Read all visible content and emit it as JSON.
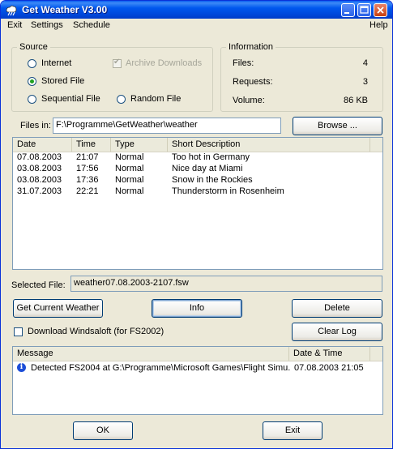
{
  "window": {
    "title": "Get Weather V3.00"
  },
  "menu": [
    "Exit",
    "Settings",
    "Schedule",
    "Help"
  ],
  "source": {
    "title": "Source",
    "internet": "Internet",
    "stored_file": "Stored File",
    "sequential_file": "Sequential File",
    "random_file": "Random File",
    "archive_downloads": "Archive Downloads",
    "selected": "Stored File"
  },
  "information": {
    "title": "Information",
    "rows": [
      {
        "label": "Files:",
        "value": "4"
      },
      {
        "label": "Requests:",
        "value": "3"
      },
      {
        "label": "Volume:",
        "value": "86 KB"
      }
    ]
  },
  "files_in": {
    "label": "Files in:",
    "value": "F:\\Programme\\GetWeather\\weather",
    "browse": "Browse ..."
  },
  "files_table": {
    "columns": [
      "Date",
      "Time",
      "Type",
      "Short Description"
    ],
    "rows": [
      [
        "07.08.2003",
        "21:07",
        "Normal",
        "Too hot in Germany"
      ],
      [
        "03.08.2003",
        "17:56",
        "Normal",
        "Nice day at Miami"
      ],
      [
        "03.08.2003",
        "17:36",
        "Normal",
        "Snow in the Rockies"
      ],
      [
        "31.07.2003",
        "22:21",
        "Normal",
        "Thunderstorm in Rosenheim"
      ]
    ]
  },
  "selected_file": {
    "label": "Selected File:",
    "value": "weather07.08.2003-2107.fsw"
  },
  "buttons": {
    "get_current_weather": "Get Current Weather",
    "info": "Info",
    "delete": "Delete",
    "clear_log": "Clear Log",
    "ok": "OK",
    "exit": "Exit"
  },
  "download_windsaloft": "Download Windsaloft (for FS2002)",
  "log_table": {
    "columns": [
      "Message",
      "Date & Time"
    ],
    "rows": [
      {
        "icon": "info-icon",
        "message": "Detected FS2004 at G:\\Programme\\Microsoft Games\\Flight Simu...",
        "datetime": "07.08.2003 21:05"
      }
    ]
  }
}
